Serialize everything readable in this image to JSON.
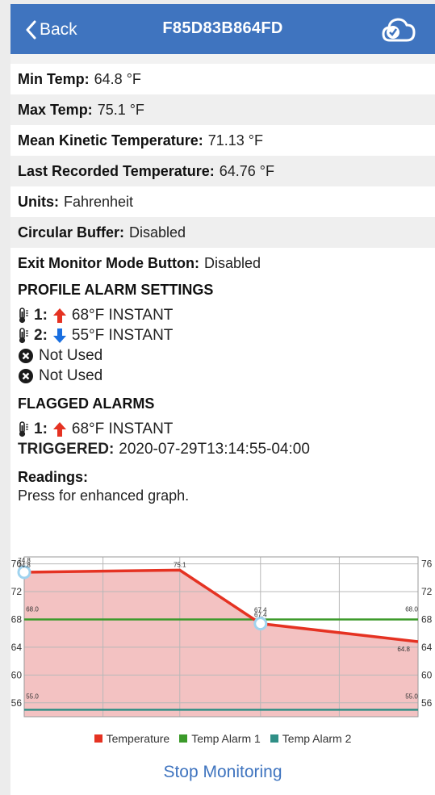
{
  "nav": {
    "back_label": "Back",
    "title": "F85D83B864FD",
    "icons": {
      "back": "chevron-left-icon",
      "cloud": "cloud-sync-icon"
    },
    "color": "#3f74bf"
  },
  "details": [
    {
      "label": "Min Temp:",
      "value": "64.8 °F"
    },
    {
      "label": "Max Temp:",
      "value": "75.1 °F"
    },
    {
      "label": "Mean Kinetic Temperature:",
      "value": "71.13 °F"
    },
    {
      "label": "Last Recorded Temperature:",
      "value": "64.76 °F"
    },
    {
      "label": "Units:",
      "value": "Fahrenheit"
    },
    {
      "label": "Circular Buffer:",
      "value": "Disabled"
    },
    {
      "label": "Exit Monitor Mode Button:",
      "value": "Disabled"
    }
  ],
  "profile_alarms": {
    "heading": "PROFILE ALARM SETTINGS",
    "items": [
      {
        "num": "1:",
        "direction": "up",
        "text": "68°F INSTANT",
        "icon": "thermometer-icon",
        "arrow_color": "#e53222"
      },
      {
        "num": "2:",
        "direction": "down",
        "text": "55°F INSTANT",
        "icon": "thermometer-icon",
        "arrow_color": "#1a6fe0"
      },
      {
        "text": "Not Used",
        "icon": "close-circle-icon"
      },
      {
        "text": "Not Used",
        "icon": "close-circle-icon"
      }
    ]
  },
  "flagged_alarms": {
    "heading": "FLAGGED ALARMS",
    "num": "1:",
    "text": "68°F INSTANT",
    "triggered_label": "TRIGGERED:",
    "triggered_value": "2020-07-29T13:14:55-04:00"
  },
  "readings": {
    "title": "Readings:",
    "subtitle": "Press for enhanced graph."
  },
  "chart_data": {
    "type": "line",
    "ylim": [
      54,
      77
    ],
    "yticks_left": [
      "76",
      "72",
      "68",
      "64",
      "60",
      "56"
    ],
    "yticks_right": [
      "76",
      "72",
      "68",
      "64",
      "60",
      "56"
    ],
    "ytick_values": [
      76,
      72,
      68,
      64,
      60,
      56
    ],
    "grid": true,
    "legend_position": "bottom",
    "series": [
      {
        "name": "Temperature",
        "color": "#e53222",
        "fill": "#f3c2c2",
        "points": [
          {
            "x": 0,
            "y": 74.8
          },
          {
            "x": 0.395,
            "y": 75.1
          },
          {
            "x": 0.6,
            "y": 67.4
          },
          {
            "x": 1,
            "y": 64.8
          }
        ],
        "labels": [
          {
            "at": 0,
            "text": "74.8"
          },
          {
            "at": 0,
            "text": "74.8"
          },
          {
            "at": 1,
            "text": "75.1"
          },
          {
            "at": 2,
            "text": "67.4"
          },
          {
            "at": 2,
            "text": "67.4"
          },
          {
            "at": 3,
            "text": "64.8"
          }
        ]
      },
      {
        "name": "Temp Alarm 1",
        "color": "#3b9a2a",
        "value": 68,
        "labels": [
          "68.0",
          "68.0"
        ]
      },
      {
        "name": "Temp Alarm 2",
        "color": "#2f8f86",
        "value": 55,
        "labels": [
          "55.0",
          "55.0"
        ]
      }
    ]
  },
  "stop_button": "Stop Monitoring"
}
